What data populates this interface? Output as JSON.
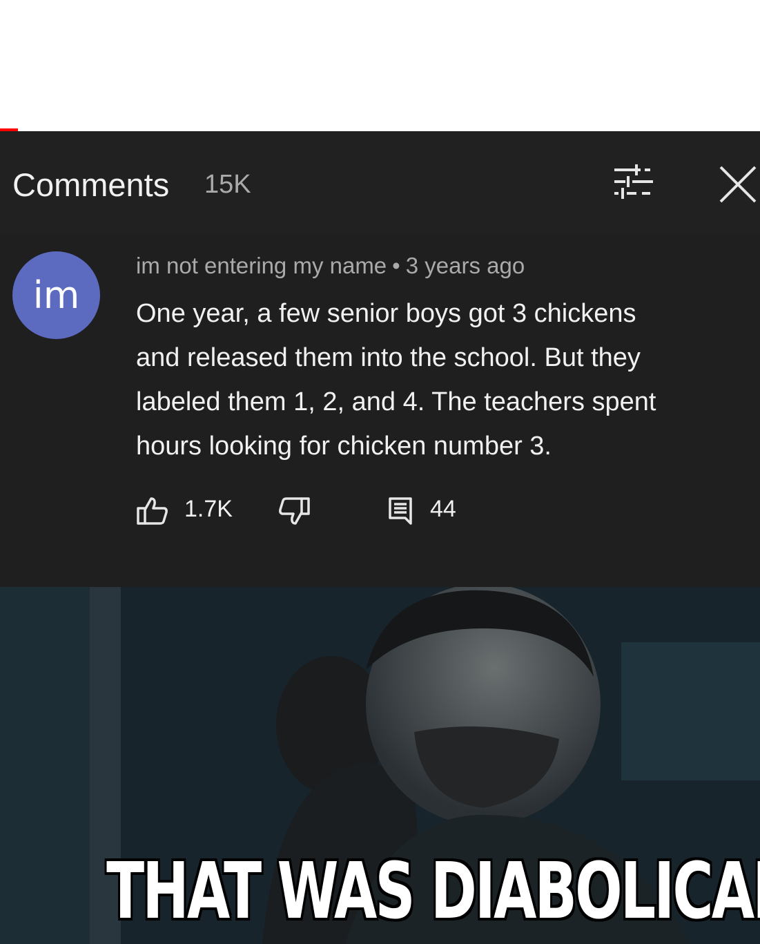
{
  "colors": {
    "accent": "#ff0000",
    "panel_bg": "#212121",
    "avatar_bg": "#5c6bc0",
    "text_primary": "#f1f1f1",
    "text_secondary": "#aaaaaa"
  },
  "header": {
    "title": "Comments",
    "count": "15K",
    "sort_icon": "sort-sliders-icon",
    "close_icon": "close-icon"
  },
  "comment": {
    "avatar_initials": "im",
    "author": "im not entering my name",
    "separator": "•",
    "time": "3 years ago",
    "body_lines": [
      "One year, a few senior boys got 3 chickens",
      "and released them into the school. But they",
      "labeled them 1, 2, and 4. The teachers spent",
      "hours looking for chicken number 3."
    ],
    "likes": "1.7K",
    "replies": "44",
    "like_icon": "thumbs-up-icon",
    "dislike_icon": "thumbs-down-icon",
    "reply_icon": "reply-icon"
  },
  "meme": {
    "caption": "THAT WAS DIABOLICAL"
  }
}
